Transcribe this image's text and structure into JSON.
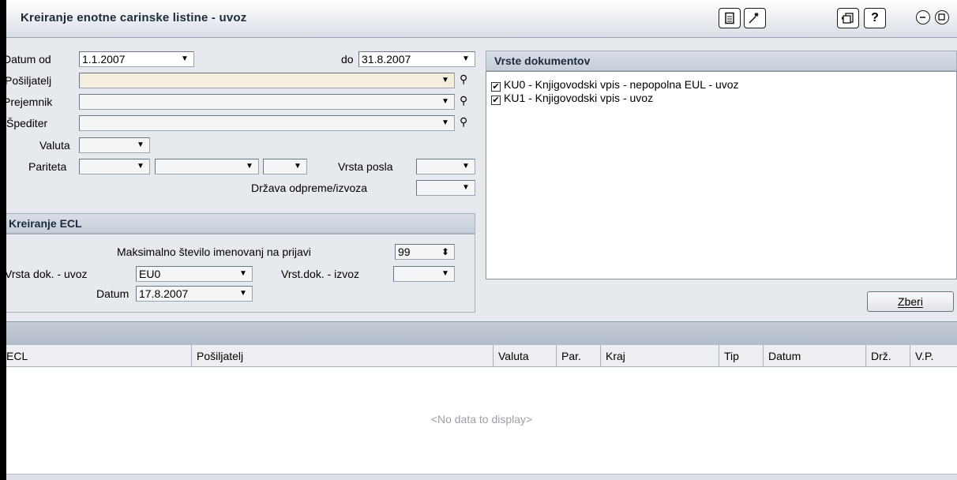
{
  "window": {
    "title": "Kreiranje enotne carinske listine - uvoz",
    "toolbar_icons": [
      "document-icon",
      "wizard-icon",
      "copy-icon",
      "help-icon",
      "minimize-icon",
      "restore-icon"
    ],
    "help_label": "?"
  },
  "filters": {
    "datum_od_label": "Datum od",
    "datum_od_value": "1.1.2007",
    "do_label": "do",
    "do_value": "31.8.2007",
    "posiljatelj_label": "Pošiljatelj",
    "posiljatelj_value": "",
    "prejemnik_label": "Prejemnik",
    "prejemnik_value": "",
    "spediter_label": "Špediter",
    "spediter_value": "",
    "valuta_label": "Valuta",
    "valuta_value": "",
    "pariteta_label": "Pariteta",
    "pariteta_value_1": "",
    "pariteta_value_2": "",
    "pariteta_value_3": "",
    "vrsta_posla_label": "Vrsta posla",
    "vrsta_posla_value": "",
    "drzava_label": "Država odpreme/izvoza",
    "drzava_value": ""
  },
  "kreiranje": {
    "header": "Kreiranje ECL",
    "max_label": "Maksimalno število imenovanj na prijavi",
    "max_value": "99",
    "vrsta_uvoz_label": "Vrsta dok. - uvoz",
    "vrsta_uvoz_value": "EU0",
    "vrsta_izvoz_label": "Vrst.dok. - izvoz",
    "vrsta_izvoz_value": "",
    "datum_label": "Datum",
    "datum_value": "17.8.2007"
  },
  "documents": {
    "header": "Vrste dokumentov",
    "items": [
      {
        "label": "KU0 - Knjigovodski vpis - nepopolna EUL - uvoz",
        "checked": true
      },
      {
        "label": "KU1 - Knjigovodski vpis - uvoz",
        "checked": true
      }
    ]
  },
  "actions": {
    "zberi_label": "Zberi"
  },
  "grid": {
    "columns": [
      "ECL",
      "Pošiljatelj",
      "Valuta",
      "Par.",
      "Kraj",
      "Tip",
      "Datum",
      "Drž.",
      "V.P."
    ],
    "empty_text": "<No data to display>"
  },
  "colors": {
    "accent": "#1e2a3a",
    "background": "#e6e9ee",
    "tinted_field": "#f3efdc"
  }
}
